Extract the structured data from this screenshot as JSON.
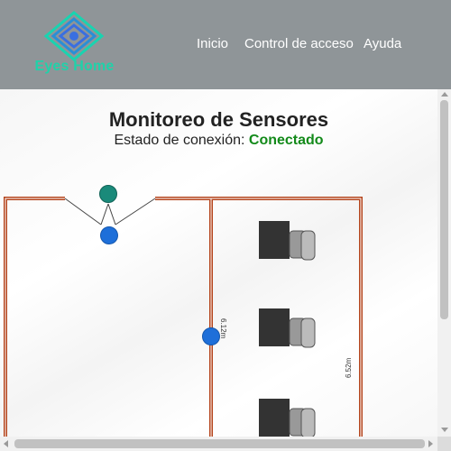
{
  "brand": {
    "name": "Eyes Home",
    "logo_icon": "eye-diamond-icon",
    "color": "#1fd2a9"
  },
  "nav": {
    "items": [
      "Inicio",
      "Control de acceso",
      "Ayuda"
    ]
  },
  "main": {
    "title": "Monitoreo de Sensores",
    "status_label": "Estado de conexión:",
    "status_value": "Conectado",
    "status_color": "#138a1a"
  },
  "floorplan": {
    "dim_corridor": "6.12m",
    "dim_room": "6.52m",
    "sensor_colors": {
      "blue": "#1e6fd9",
      "teal": "#1a8a7a"
    },
    "wall_color": "#b4441c"
  }
}
